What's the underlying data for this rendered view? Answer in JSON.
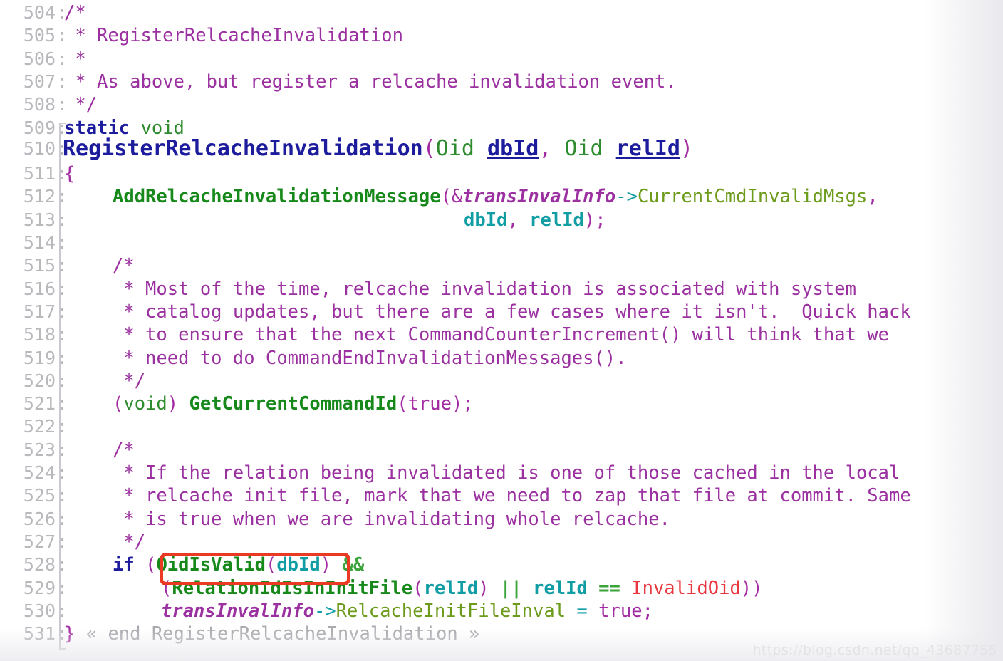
{
  "editor": {
    "language": "C",
    "first_line": 504,
    "last_line": 531,
    "gutter_separator": ":",
    "fold_marker_start_line": 509,
    "fold_marker_end_line": 531
  },
  "colors": {
    "background": "#ffffff",
    "line_number": "#b9b9bd",
    "comment": "#9B30A0",
    "keyword": "#1c1c9c",
    "type": "#2E8B2E",
    "function": "#17891b",
    "parameter_decl": "#1c1c9c",
    "variable": "#119da4",
    "global_var": "#9B30A0",
    "struct_member": "#6d9b1c",
    "punctuation": "#a32ca3",
    "logical_operator": "#3aa33a",
    "macro_constant": "#e8373f",
    "fold_hint": "#a9a9ae",
    "annotation_red": "#ea3a23",
    "watermark": "#e3e3e6"
  },
  "annotation": {
    "type": "rounded-rectangle-highlight",
    "target_text": "OidIsValid(dbId)",
    "on_line": 528,
    "color": "#ea3a23"
  },
  "watermark": {
    "text": "https://blog.csdn.net/qq_43687755"
  },
  "lines": [
    {
      "n": "504",
      "indent": 0,
      "tokens": [
        {
          "t": "/*",
          "c": "t-comment"
        }
      ]
    },
    {
      "n": "505",
      "indent": 0,
      "tokens": [
        {
          "t": " * RegisterRelcacheInvalidation",
          "c": "t-comment"
        }
      ]
    },
    {
      "n": "506",
      "indent": 0,
      "tokens": [
        {
          "t": " *",
          "c": "t-comment"
        }
      ]
    },
    {
      "n": "507",
      "indent": 0,
      "tokens": [
        {
          "t": " * As above, but register a relcache invalidation event.",
          "c": "t-comment"
        }
      ]
    },
    {
      "n": "508",
      "indent": 0,
      "tokens": [
        {
          "t": " */",
          "c": "t-comment"
        }
      ]
    },
    {
      "n": "509",
      "indent": 0,
      "tokens": [
        {
          "t": "static",
          "c": "t-kw"
        },
        {
          "t": " ",
          "c": "t-plain"
        },
        {
          "t": "void",
          "c": "t-type"
        }
      ]
    },
    {
      "n": "510",
      "indent": 0,
      "big": true,
      "tokens": [
        {
          "t": "RegisterRelcacheInvalidation",
          "c": "t-title"
        },
        {
          "t": "(",
          "c": "t-punc"
        },
        {
          "t": "Oid",
          "c": "t-type"
        },
        {
          "t": " ",
          "c": "t-plain"
        },
        {
          "t": "dbId",
          "c": "t-param"
        },
        {
          "t": ",",
          "c": "t-punc"
        },
        {
          "t": " ",
          "c": "t-plain"
        },
        {
          "t": "Oid",
          "c": "t-type"
        },
        {
          "t": " ",
          "c": "t-plain"
        },
        {
          "t": "relId",
          "c": "t-param"
        },
        {
          "t": ")",
          "c": "t-punc"
        }
      ]
    },
    {
      "n": "511",
      "indent": 0,
      "tokens": [
        {
          "t": "{",
          "c": "t-brace"
        }
      ]
    },
    {
      "n": "512",
      "indent": 4,
      "tokens": [
        {
          "t": "AddRelcacheInvalidationMessage",
          "c": "t-fn"
        },
        {
          "t": "(&",
          "c": "t-punc"
        },
        {
          "t": "transInvalInfo",
          "c": "t-global"
        },
        {
          "t": "->",
          "c": "t-op"
        },
        {
          "t": "CurrentCmdInvalidMsgs",
          "c": "t-member"
        },
        {
          "t": ",",
          "c": "t-punc"
        }
      ]
    },
    {
      "n": "513",
      "indent": 33,
      "tokens": [
        {
          "t": "dbId",
          "c": "t-var"
        },
        {
          "t": ",",
          "c": "t-punc"
        },
        {
          "t": " ",
          "c": "t-plain"
        },
        {
          "t": "relId",
          "c": "t-var"
        },
        {
          "t": ");",
          "c": "t-punc"
        }
      ]
    },
    {
      "n": "514",
      "indent": 0,
      "tokens": []
    },
    {
      "n": "515",
      "indent": 4,
      "tokens": [
        {
          "t": "/*",
          "c": "t-comment"
        }
      ]
    },
    {
      "n": "516",
      "indent": 4,
      "tokens": [
        {
          "t": " * Most of the time, relcache invalidation is associated with system",
          "c": "t-comment"
        }
      ]
    },
    {
      "n": "517",
      "indent": 4,
      "tokens": [
        {
          "t": " * catalog updates, but there are a few cases where it isn't.  Quick hack",
          "c": "t-comment"
        }
      ]
    },
    {
      "n": "518",
      "indent": 4,
      "tokens": [
        {
          "t": " * to ensure that the next CommandCounterIncrement() will think that we",
          "c": "t-comment"
        }
      ]
    },
    {
      "n": "519",
      "indent": 4,
      "tokens": [
        {
          "t": " * need to do CommandEndInvalidationMessages().",
          "c": "t-comment"
        }
      ]
    },
    {
      "n": "520",
      "indent": 4,
      "tokens": [
        {
          "t": " */",
          "c": "t-comment"
        }
      ]
    },
    {
      "n": "521",
      "indent": 4,
      "tokens": [
        {
          "t": "(",
          "c": "t-punc"
        },
        {
          "t": "void",
          "c": "t-type"
        },
        {
          "t": ")",
          "c": "t-punc"
        },
        {
          "t": " ",
          "c": "t-plain"
        },
        {
          "t": "GetCurrentCommandId",
          "c": "t-fn"
        },
        {
          "t": "(",
          "c": "t-punc"
        },
        {
          "t": "true",
          "c": "t-const"
        },
        {
          "t": ");",
          "c": "t-punc"
        }
      ]
    },
    {
      "n": "522",
      "indent": 0,
      "tokens": []
    },
    {
      "n": "523",
      "indent": 4,
      "tokens": [
        {
          "t": "/*",
          "c": "t-comment"
        }
      ]
    },
    {
      "n": "524",
      "indent": 4,
      "tokens": [
        {
          "t": " * If the relation being invalidated is one of those cached in the local",
          "c": "t-comment"
        }
      ]
    },
    {
      "n": "525",
      "indent": 4,
      "tokens": [
        {
          "t": " * relcache init file, mark that we need to zap that file at commit. Same",
          "c": "t-comment"
        }
      ]
    },
    {
      "n": "526",
      "indent": 4,
      "tokens": [
        {
          "t": " * is true when we are invalidating whole relcache.",
          "c": "t-comment"
        }
      ]
    },
    {
      "n": "527",
      "indent": 4,
      "tokens": [
        {
          "t": " */",
          "c": "t-comment"
        }
      ]
    },
    {
      "n": "528",
      "indent": 4,
      "tokens": [
        {
          "t": "if",
          "c": "t-kw"
        },
        {
          "t": " ",
          "c": "t-plain"
        },
        {
          "t": "(",
          "c": "t-punc"
        },
        {
          "t": "OidIsValid",
          "c": "t-fn"
        },
        {
          "t": "(",
          "c": "t-punc"
        },
        {
          "t": "dbId",
          "c": "t-var"
        },
        {
          "t": ")",
          "c": "t-punc"
        },
        {
          "t": " ",
          "c": "t-plain"
        },
        {
          "t": "&&",
          "c": "t-logic"
        }
      ]
    },
    {
      "n": "529",
      "indent": 8,
      "tokens": [
        {
          "t": "(",
          "c": "t-punc"
        },
        {
          "t": "RelationIdIsInInitFile",
          "c": "t-fn"
        },
        {
          "t": "(",
          "c": "t-punc"
        },
        {
          "t": "relId",
          "c": "t-var"
        },
        {
          "t": ")",
          "c": "t-punc"
        },
        {
          "t": " ",
          "c": "t-plain"
        },
        {
          "t": "||",
          "c": "t-logic"
        },
        {
          "t": " ",
          "c": "t-plain"
        },
        {
          "t": "relId",
          "c": "t-var"
        },
        {
          "t": " ",
          "c": "t-plain"
        },
        {
          "t": "==",
          "c": "t-logic"
        },
        {
          "t": " ",
          "c": "t-plain"
        },
        {
          "t": "InvalidOid",
          "c": "t-macro"
        },
        {
          "t": "))",
          "c": "t-punc"
        }
      ]
    },
    {
      "n": "530",
      "indent": 8,
      "tokens": [
        {
          "t": "transInvalInfo",
          "c": "t-global"
        },
        {
          "t": "->",
          "c": "t-op"
        },
        {
          "t": "RelcacheInitFileInval",
          "c": "t-member"
        },
        {
          "t": " ",
          "c": "t-plain"
        },
        {
          "t": "=",
          "c": "t-op"
        },
        {
          "t": " ",
          "c": "t-plain"
        },
        {
          "t": "true",
          "c": "t-const"
        },
        {
          "t": ";",
          "c": "t-punc"
        }
      ]
    },
    {
      "n": "531",
      "indent": 0,
      "tokens": [
        {
          "t": "}",
          "c": "t-brace"
        },
        {
          "t": " ",
          "c": "t-plain"
        },
        {
          "t": "« end RegisterRelcacheInvalidation »",
          "c": "t-fold"
        }
      ]
    }
  ]
}
